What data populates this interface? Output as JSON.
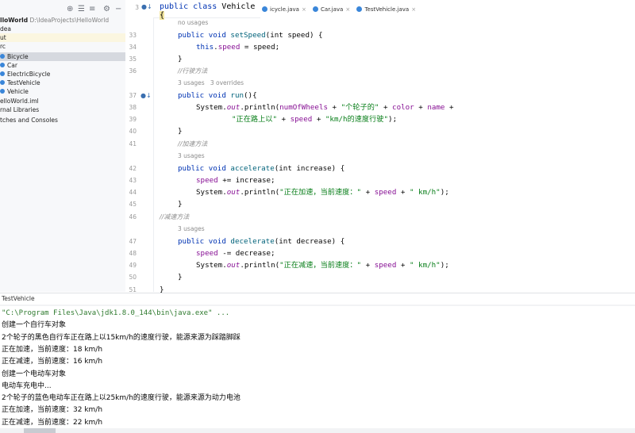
{
  "project": {
    "toolbar": {
      "target_icon": "⊕",
      "collapse_icon": "☰",
      "expand_icon": "≡",
      "gear_icon": "⚙",
      "hide_icon": "−"
    },
    "rows": [
      {
        "text": "lloWorld",
        "extra": "D:\\IdeaProjects\\HelloWorld",
        "state": "normal"
      },
      {
        "text": "dea",
        "extra": "",
        "state": "normal"
      },
      {
        "text": "ut",
        "extra": "",
        "state": "hl"
      },
      {
        "text": "rc",
        "extra": "",
        "state": "normal"
      },
      {
        "text": "Bicycle",
        "extra": "",
        "state": "sel"
      },
      {
        "text": "Car",
        "extra": "",
        "state": "normal"
      },
      {
        "text": "ElectricBicycle",
        "extra": "",
        "state": "normal"
      },
      {
        "text": "TestVehicle",
        "extra": "",
        "state": "normal"
      },
      {
        "text": "Vehicle",
        "extra": "",
        "state": "normal"
      },
      {
        "text": "elloWorld.iml",
        "extra": "",
        "state": "normal"
      },
      {
        "text": "rnal Libraries",
        "extra": "",
        "state": "normal"
      },
      {
        "text": "tches and Consoles",
        "extra": "",
        "state": "normal"
      }
    ]
  },
  "tabs": [
    "icycle.java",
    "Car.java",
    "TestVehicle.java"
  ],
  "sticky": {
    "line": "3",
    "mark": "●↓",
    "kw1": "public",
    "kw2": "class",
    "name": "Vehicle",
    "brace": "{"
  },
  "editor": {
    "lines": [
      {
        "n": "",
        "t": "hint",
        "text": "no usages"
      },
      {
        "n": "33",
        "t": "code",
        "id": "l33"
      },
      {
        "n": "34",
        "t": "code",
        "id": "l34"
      },
      {
        "n": "35",
        "t": "code",
        "id": "l35"
      },
      {
        "n": "36",
        "t": "cmt",
        "text": "//行驶方法"
      },
      {
        "n": "",
        "t": "hint",
        "text": "3 usages   3 overrides"
      },
      {
        "n": "37",
        "t": "code",
        "id": "l37"
      },
      {
        "n": "38",
        "t": "code",
        "id": "l38"
      },
      {
        "n": "39",
        "t": "code",
        "id": "l39"
      },
      {
        "n": "40",
        "t": "code",
        "id": "l40"
      },
      {
        "n": "41",
        "t": "cmt",
        "text": "//加速方法"
      },
      {
        "n": "",
        "t": "hint",
        "text": "3 usages"
      },
      {
        "n": "42",
        "t": "code",
        "id": "l42"
      },
      {
        "n": "43",
        "t": "code",
        "id": "l43"
      },
      {
        "n": "44",
        "t": "code",
        "id": "l44"
      },
      {
        "n": "45",
        "t": "code",
        "id": "l45"
      },
      {
        "n": "46",
        "t": "cmt2",
        "text": "//减速方法"
      },
      {
        "n": "",
        "t": "hint",
        "text": "3 usages"
      },
      {
        "n": "47",
        "t": "code",
        "id": "l47"
      },
      {
        "n": "48",
        "t": "code",
        "id": "l48"
      },
      {
        "n": "49",
        "t": "code",
        "id": "l49"
      },
      {
        "n": "50",
        "t": "code",
        "id": "l50"
      },
      {
        "n": "51",
        "t": "code",
        "id": "l51"
      }
    ],
    "gutter_mark": "●↓",
    "code": {
      "l33": {
        "a": "public",
        "b": " void ",
        "c": "setSpeed",
        "d": "(int speed) {"
      },
      "l34": {
        "a": "this",
        "b": ".",
        "c": "speed",
        "d": " = speed;"
      },
      "l35": "}",
      "l37": {
        "a": "public",
        "b": " void ",
        "c": "run",
        "d": "(){"
      },
      "l38": {
        "p1": "System.",
        "p2": "out",
        "p3": ".println(",
        "p4": "numOfWheels",
        "p5": " + ",
        "p6": "\"个轮子的\"",
        "p7": " + ",
        "p8": "color",
        "p9": " + ",
        "p10": "name",
        "p11": " +"
      },
      "l39": {
        "p1": "\"正在路上以\"",
        "p2": " + ",
        "p3": "speed",
        "p4": " + ",
        "p5": "\"km/h的速度行驶\"",
        "p6": ");"
      },
      "l40": "}",
      "l42": {
        "a": "public",
        "b": " void ",
        "c": "accelerate",
        "d": "(int increase) {"
      },
      "l43": {
        "a": "speed",
        "b": " += increase;"
      },
      "l44": {
        "p1": "System.",
        "p2": "out",
        "p3": ".println(",
        "p4": "\"正在加速，当前速度：\"",
        "p5": " + ",
        "p6": "speed",
        "p7": " + ",
        "p8": "\" km/h\"",
        "p9": ");"
      },
      "l45": "}",
      "l47": {
        "a": "public",
        "b": " void ",
        "c": "decelerate",
        "d": "(int decrease) {"
      },
      "l48": {
        "a": "speed",
        "b": " -= decrease;"
      },
      "l49": {
        "p1": "System.",
        "p2": "out",
        "p3": ".println(",
        "p4": "\"正在减速，当前速度：\"",
        "p5": " + ",
        "p6": "speed",
        "p7": " + ",
        "p8": "\" km/h\"",
        "p9": ");"
      },
      "l50": "}",
      "l51": "}"
    }
  },
  "run": {
    "tab": "TestVehicle",
    "output": [
      "\"C:\\Program Files\\Java\\jdk1.8.0_144\\bin\\java.exe\" ...",
      "创建一个自行车对象",
      "2个轮子的黑色自行车正在路上以15km/h的速度行驶，能源来源为踩踏脚踩",
      "正在加速，当前速度：18 km/h",
      "正在减速，当前速度：16 km/h",
      "创建一个电动车对象",
      "电动车充电中...",
      "2个轮子的蓝色电动车正在路上以25km/h的速度行驶，能源来源为动力电池",
      "正在加速，当前速度：32 km/h",
      "正在减速，当前速度：22 km/h"
    ]
  }
}
